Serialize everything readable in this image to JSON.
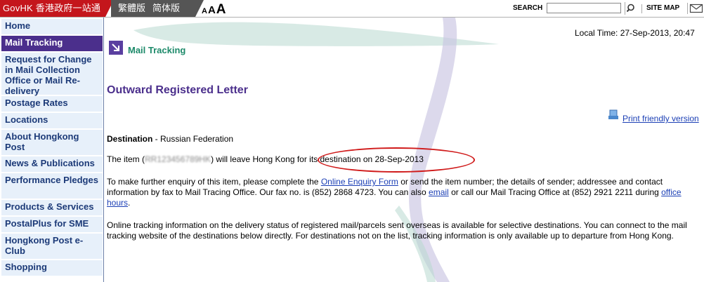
{
  "topbar": {
    "govhk_label": "GovHK 香港政府一站通",
    "lang_traditional": "繁體版",
    "lang_simplified": "简体版",
    "font_small": "A",
    "font_medium": "A",
    "font_large": "A",
    "search_label": "SEARCH",
    "search_value": "",
    "sitemap_label": "SITE MAP"
  },
  "sidebar": {
    "items": [
      {
        "label": "Home"
      },
      {
        "label": "Mail Tracking"
      },
      {
        "label": "Request for Change in Mail Collection Office or Mail Re-delivery"
      },
      {
        "label": "Postage Rates"
      },
      {
        "label": "Locations"
      },
      {
        "label": "About Hongkong Post"
      },
      {
        "label": "News & Publications"
      },
      {
        "label": "Performance Pledges"
      },
      {
        "label": "Products & Services"
      },
      {
        "label": "PostalPlus for SME"
      },
      {
        "label": "Hongkong Post e-Club"
      },
      {
        "label": "Shopping"
      }
    ]
  },
  "header": {
    "local_time": "Local Time: 27-Sep-2013, 20:47",
    "breadcrumb": "Mail Tracking"
  },
  "main": {
    "title": "Outward Registered Letter",
    "print_link": "Print friendly version",
    "destination_label": "Destination",
    "destination_value": " - Russian Federation",
    "item_prefix": "The item (",
    "item_number": "RR123456789HK",
    "item_suffix": ") will leave Hong Kong for its destination on 28-Sep-2013",
    "enquiry_part1": "To make further enquiry of this item, please complete the ",
    "enquiry_link_form": "Online Enquiry Form",
    "enquiry_part2": " or send the item number; the details of sender; addressee and contact information by fax to Mail Tracing Office. Our fax no. is (852) 2868 4723. You can also ",
    "enquiry_link_email": "email",
    "enquiry_part3": " or call our Mail Tracing Office at (852) 2921 2211 during ",
    "enquiry_link_hours": "office hours",
    "enquiry_part4": ".",
    "online_tracking_text": "Online tracking information on the delivery status of registered mail/parcels sent overseas is available for selective destinations. You can connect to the mail tracking website of the destinations below directly. For destinations not on the list, tracking information is only available up to departure from Hong Kong."
  },
  "colors": {
    "govhk_red": "#c4161c",
    "nav_active": "#4b2f8c",
    "nav_bg": "#e7f0fa",
    "title_purple": "#4b2f8c",
    "breadcrumb_green": "#1d8a6a",
    "link_blue": "#1b3fb5",
    "annotation_red": "#d01a1a"
  },
  "icons": [
    "search-icon",
    "mail-icon",
    "arrow-icon",
    "print-icon"
  ]
}
